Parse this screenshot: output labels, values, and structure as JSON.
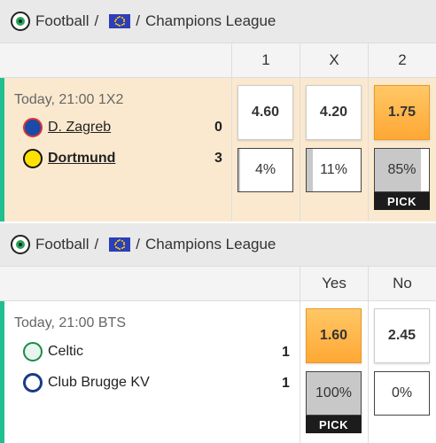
{
  "events": [
    {
      "breadcrumb": {
        "sport": "Football",
        "sep1": "/",
        "sep2": "/",
        "competition": "Champions League"
      },
      "columns": [
        "1",
        "X",
        "2"
      ],
      "time": "Today, 21:00 1X2",
      "teams": [
        {
          "name": "D. Zagreb",
          "score": "0"
        },
        {
          "name": "Dortmund",
          "score": "3"
        }
      ],
      "odds": [
        "4.60",
        "4.20",
        "1.75"
      ],
      "percentages": [
        "4%",
        "11%",
        "85%"
      ],
      "percent_values": [
        4,
        11,
        85
      ],
      "pick_label": "PICK"
    },
    {
      "breadcrumb": {
        "sport": "Football",
        "sep1": "/",
        "sep2": "/",
        "competition": "Champions League"
      },
      "columns": [
        "Yes",
        "No"
      ],
      "time": "Today, 21:00 BTS",
      "teams": [
        {
          "name": "Celtic",
          "score": "1"
        },
        {
          "name": "Club Brugge KV",
          "score": "1"
        }
      ],
      "odds": [
        "1.60",
        "2.45"
      ],
      "percentages": [
        "100%",
        "0%"
      ],
      "percent_values": [
        100,
        0
      ],
      "pick_label": "PICK"
    }
  ],
  "colors": {
    "accent": "#1fbf8f",
    "highlight_row": "#fbe9cf",
    "picked_odd": "#ffa834",
    "pick_tag": "#1c1c1c"
  }
}
